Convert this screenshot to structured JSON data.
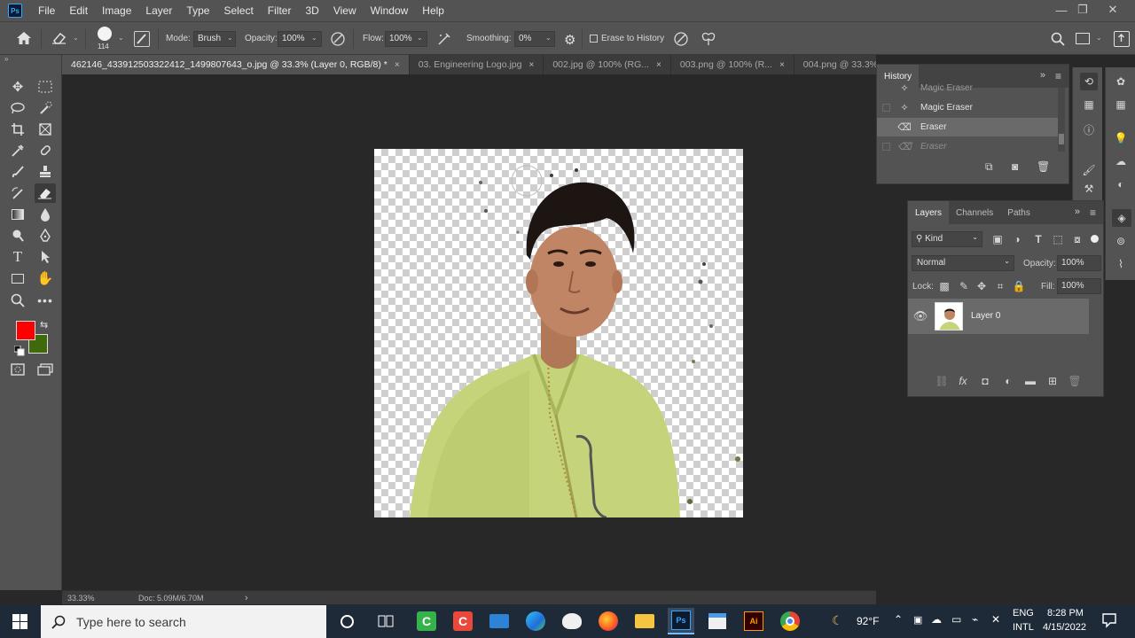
{
  "app": {
    "logo": "Ps"
  },
  "menu": [
    "File",
    "Edit",
    "Image",
    "Layer",
    "Type",
    "Select",
    "Filter",
    "3D",
    "View",
    "Window",
    "Help"
  ],
  "window_controls": {
    "minimize": "—",
    "restore": "❐",
    "close": "✕"
  },
  "options": {
    "brush_size": "114",
    "mode_label": "Mode:",
    "mode_value": "Brush",
    "opacity_label": "Opacity:",
    "opacity_value": "100%",
    "flow_label": "Flow:",
    "flow_value": "100%",
    "smoothing_label": "Smoothing:",
    "smoothing_value": "0%",
    "erase_history_label": "Erase to History"
  },
  "tabs": [
    {
      "label": "462146_433912503322412_1499807643_o.jpg @ 33.3% (Layer 0, RGB/8) *",
      "close": "×"
    },
    {
      "label": "03. Engineering Logo.jpg",
      "close": "×"
    },
    {
      "label": "002.jpg @ 100% (RG...",
      "close": "×"
    },
    {
      "label": "003.png @ 100% (R...",
      "close": "×"
    },
    {
      "label": "004.png @ 33.3%",
      "close": ""
    }
  ],
  "history": {
    "title": "History",
    "items": [
      {
        "label": "Magic Eraser",
        "icon": "magic-eraser-icon"
      },
      {
        "label": "Magic Eraser",
        "icon": "magic-eraser-icon"
      },
      {
        "label": "Eraser",
        "icon": "eraser-icon"
      },
      {
        "label": "Eraser",
        "icon": "eraser-icon"
      }
    ]
  },
  "layers": {
    "tabs": [
      "Layers",
      "Channels",
      "Paths"
    ],
    "filter_label": "Kind",
    "blend_mode": "Normal",
    "opacity_label": "Opacity:",
    "opacity_value": "100%",
    "lock_label": "Lock:",
    "fill_label": "Fill:",
    "fill_value": "100%",
    "items": [
      {
        "name": "Layer 0",
        "visible": true
      }
    ]
  },
  "status": {
    "zoom": "33.33%",
    "doc": "Doc: 5.09M/6.70M",
    "arrow": "›"
  },
  "colors": {
    "foreground": "#ff0000",
    "background": "#3f6a0c",
    "accent": "#31a8ff"
  },
  "taskbar": {
    "search_placeholder": "Type here to search",
    "weather": "92°F",
    "lang_1": "ENG",
    "lang_2": "INTL",
    "time": "8:28 PM",
    "date": "4/15/2022"
  }
}
